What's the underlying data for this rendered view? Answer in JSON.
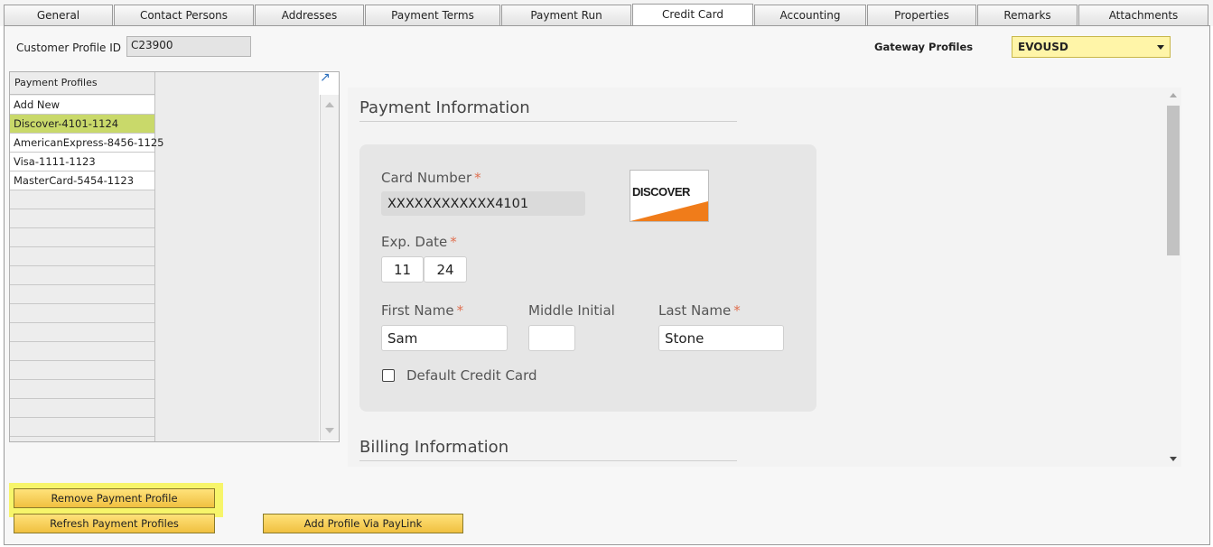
{
  "tabs": [
    "General",
    "Contact Persons",
    "Addresses",
    "Payment Terms",
    "Payment Run",
    "Credit Card",
    "Accounting",
    "Properties",
    "Remarks",
    "Attachments"
  ],
  "active_tab": "Credit Card",
  "header": {
    "customer_profile_label": "Customer Profile ID",
    "customer_profile_value": "C23900",
    "gateway_label": "Gateway Profiles",
    "gateway_value": "EVOUSD"
  },
  "profiles": {
    "header": "Payment Profiles",
    "items": [
      "Add New",
      "Discover-4101-1124",
      "AmericanExpress-8456-1125",
      "Visa-1111-1123",
      "MasterCard-5454-1123"
    ],
    "selected": "Discover-4101-1124"
  },
  "payment_info": {
    "title": "Payment Information",
    "card_number_label": "Card Number",
    "card_number_value": "XXXXXXXXXXXX4101",
    "card_logo": "DISCOVER",
    "exp_label": "Exp. Date",
    "exp_month": "11",
    "exp_year": "24",
    "first_name_label": "First Name",
    "first_name_value": "Sam",
    "middle_label": "Middle Initial",
    "middle_value": "",
    "last_name_label": "Last Name",
    "last_name_value": "Stone",
    "default_label": "Default Credit Card",
    "default_checked": false,
    "required_mark": "*"
  },
  "billing_info": {
    "title": "Billing Information"
  },
  "buttons": {
    "remove": "Remove Payment Profile",
    "refresh": "Refresh Payment Profiles",
    "paylink": "Add Profile Via PayLink"
  },
  "colors": {
    "highlight": "#f7f56a",
    "selected_row": "#c9d96a",
    "button": "#f0c040",
    "required": "#e07050"
  }
}
